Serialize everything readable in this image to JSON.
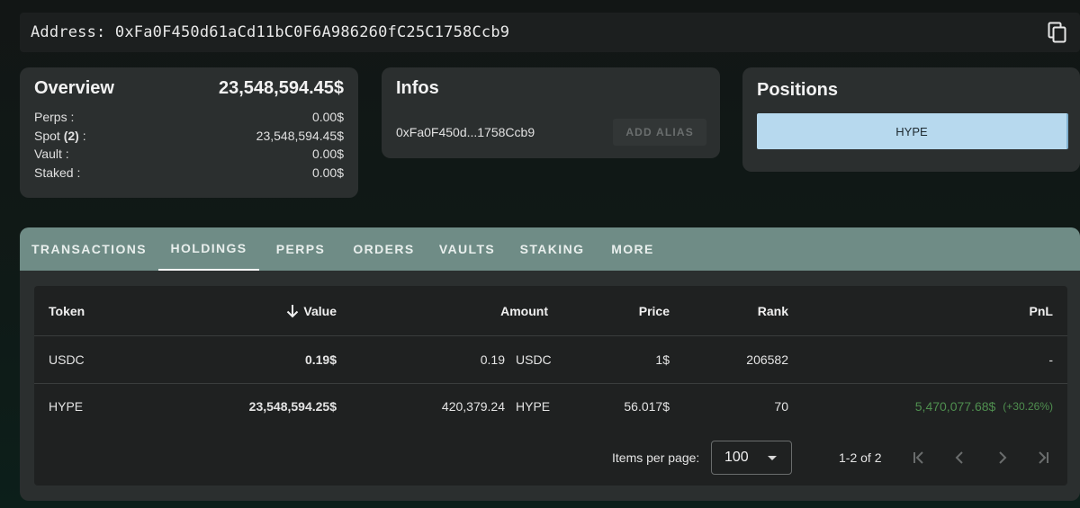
{
  "address": {
    "label": "Address:",
    "value": "0xFa0F450d61aCd11bC0F6A986260fC25C1758Ccb9"
  },
  "overview": {
    "title": "Overview",
    "total": "23,548,594.45$",
    "rows": [
      {
        "label": "Perps :",
        "value": "0.00$"
      },
      {
        "label_prefix": "Spot",
        "label_count": "(2)",
        "label_suffix": ":",
        "value": "23,548,594.45$"
      },
      {
        "label": "Vault :",
        "value": "0.00$"
      },
      {
        "label": "Staked :",
        "value": "0.00$"
      }
    ]
  },
  "infos": {
    "title": "Infos",
    "short_address": "0xFa0F450d...1758Ccb9",
    "alias_button": "ADD ALIAS"
  },
  "positions": {
    "title": "Positions",
    "items": [
      {
        "label": "HYPE",
        "share": 1.0
      }
    ]
  },
  "tabs": [
    {
      "label": "TRANSACTIONS",
      "active": false
    },
    {
      "label": "HOLDINGS",
      "active": true
    },
    {
      "label": "PERPS",
      "active": false
    },
    {
      "label": "ORDERS",
      "active": false
    },
    {
      "label": "VAULTS",
      "active": false
    },
    {
      "label": "STAKING",
      "active": false
    },
    {
      "label": "MORE",
      "active": false
    }
  ],
  "table": {
    "headers": {
      "token": "Token",
      "value": "Value",
      "amount": "Amount",
      "price": "Price",
      "rank": "Rank",
      "pnl": "PnL"
    },
    "sort_icon": "arrow-down-icon",
    "rows": [
      {
        "token": "USDC",
        "value": "0.19$",
        "amount": "0.19",
        "amount_unit": "USDC",
        "price": "1$",
        "rank": "206582",
        "pnl": "-",
        "pnl_pct": ""
      },
      {
        "token": "HYPE",
        "value": "23,548,594.25$",
        "amount": "420,379.24",
        "amount_unit": "HYPE",
        "price": "56.017$",
        "rank": "70",
        "pnl": "5,470,077.68$",
        "pnl_pct": "(+30.26%)"
      }
    ]
  },
  "pagination": {
    "items_per_page_label": "Items per page:",
    "items_per_page": "100",
    "range": "1-2 of 2"
  },
  "colors": {
    "positive": "#4f8f4f",
    "tab_bar": "#6f8c86",
    "position_bar": "#b7d9ee"
  }
}
